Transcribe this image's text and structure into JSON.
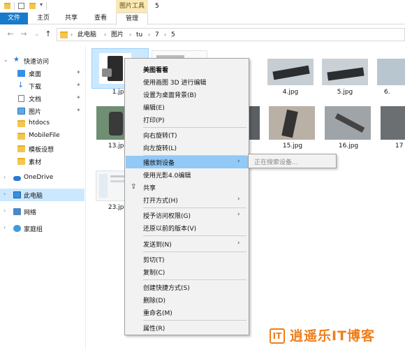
{
  "titlebar": {
    "tool_context": "图片工具",
    "title": "5"
  },
  "ribbon": {
    "tabs": [
      {
        "label": "文件"
      },
      {
        "label": "主页"
      },
      {
        "label": "共享"
      },
      {
        "label": "查看"
      },
      {
        "label": "管理"
      }
    ]
  },
  "address": {
    "crumbs": [
      "此电脑",
      "图片",
      "tu",
      "7",
      "5"
    ]
  },
  "nav": {
    "items": [
      {
        "label": "快速访问"
      },
      {
        "label": "桌面"
      },
      {
        "label": "下载"
      },
      {
        "label": "文档"
      },
      {
        "label": "图片"
      },
      {
        "label": "htdocs"
      },
      {
        "label": "MobileFile"
      },
      {
        "label": "模板设想"
      },
      {
        "label": "素材"
      },
      {
        "label": "OneDrive"
      },
      {
        "label": "此电脑"
      },
      {
        "label": "网络"
      },
      {
        "label": "家庭组"
      }
    ]
  },
  "files": [
    {
      "name": "1.jpg"
    },
    {
      "name": "4.jpg"
    },
    {
      "name": "5.jpg"
    },
    {
      "name": "6."
    },
    {
      "name": "13.jpg"
    },
    {
      "name": "15.jpg"
    },
    {
      "name": "16.jpg"
    },
    {
      "name": "17"
    },
    {
      "name": "23.jpg"
    }
  ],
  "context_menu": {
    "items": [
      {
        "label": "美图看看"
      },
      {
        "label": "使用画图 3D 进行编辑"
      },
      {
        "label": "设置为桌面背景(B)"
      },
      {
        "label": "编辑(E)"
      },
      {
        "label": "打印(P)"
      },
      {
        "label": "向右旋转(T)"
      },
      {
        "label": "向左旋转(L)"
      },
      {
        "label": "播放到设备"
      },
      {
        "label": "使用光影4.0编辑"
      },
      {
        "label": "共享"
      },
      {
        "label": "打开方式(H)"
      },
      {
        "label": "授予访问权限(G)"
      },
      {
        "label": "还原以前的版本(V)"
      },
      {
        "label": "发送到(N)"
      },
      {
        "label": "剪切(T)"
      },
      {
        "label": "复制(C)"
      },
      {
        "label": "创建快捷方式(S)"
      },
      {
        "label": "删除(D)"
      },
      {
        "label": "重命名(M)"
      },
      {
        "label": "属性(R)"
      }
    ]
  },
  "submenu": {
    "label": "正在搜索设备..."
  },
  "watermark": {
    "badge": "IT",
    "text": "逍遥乐IT博客"
  },
  "colors": {
    "accent": "#1979ca",
    "selection": "#cce8ff",
    "menu_highlight": "#91c9f7",
    "watermark": "#ef7d1a"
  }
}
